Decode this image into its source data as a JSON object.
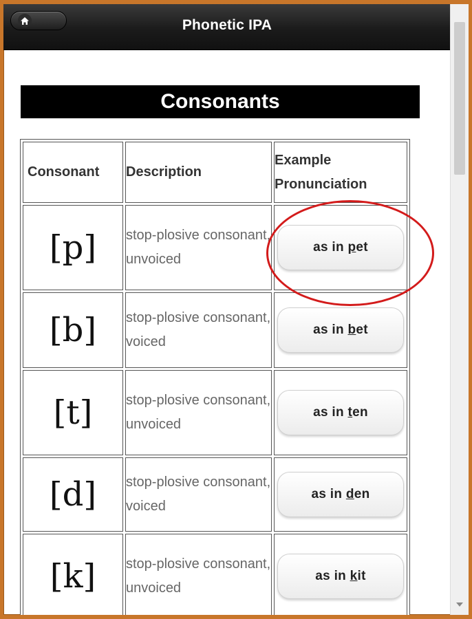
{
  "header": {
    "title": "Phonetic IPA",
    "home_icon": "home-icon"
  },
  "section": {
    "title": "Consonants"
  },
  "table": {
    "columns": [
      "Consonant",
      "Description",
      "Example Pronunciation"
    ],
    "rows": [
      {
        "symbol": "[p]",
        "description": "stop-plosive consonant, unvoiced",
        "example": {
          "prefix": "as in ",
          "underlined": "p",
          "suffix": "et"
        }
      },
      {
        "symbol": "[b]",
        "description": "stop-plosive consonant, voiced",
        "example": {
          "prefix": "as in ",
          "underlined": "b",
          "suffix": "et"
        }
      },
      {
        "symbol": "[t]",
        "description": "stop-plosive consonant, unvoiced",
        "example": {
          "prefix": "as in ",
          "underlined": "t",
          "suffix": "en"
        }
      },
      {
        "symbol": "[d]",
        "description": "stop-plosive consonant, voiced",
        "example": {
          "prefix": "as in ",
          "underlined": "d",
          "suffix": "en"
        }
      },
      {
        "symbol": "[k]",
        "description": "stop-plosive consonant, unvoiced",
        "example": {
          "prefix": "as in ",
          "underlined": "k",
          "suffix": "it"
        }
      }
    ]
  },
  "annotation": {
    "highlight_color": "#d31b1b"
  },
  "colors": {
    "outer_border": "#c8762a",
    "header_bg": "#1b1b1b"
  }
}
